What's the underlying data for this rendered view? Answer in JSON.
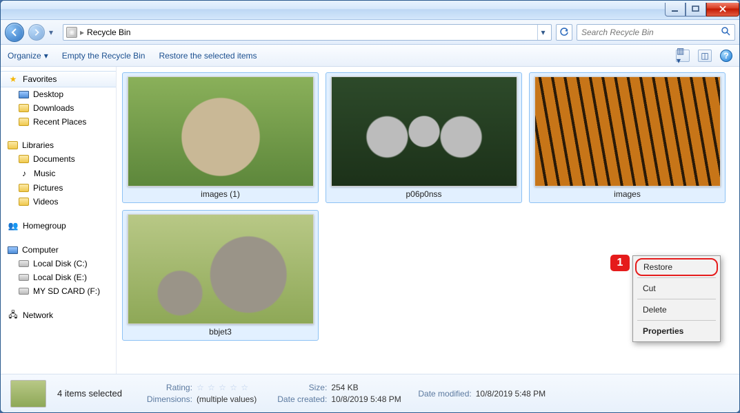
{
  "window": {
    "title": "Recycle Bin"
  },
  "nav": {
    "breadcrumb": "Recycle Bin",
    "search_placeholder": "Search Recycle Bin"
  },
  "toolbar": {
    "organize": "Organize",
    "empty": "Empty the Recycle Bin",
    "restore": "Restore the selected items"
  },
  "sidebar": {
    "favorites": {
      "label": "Favorites",
      "items": [
        "Desktop",
        "Downloads",
        "Recent Places"
      ]
    },
    "libraries": {
      "label": "Libraries",
      "items": [
        "Documents",
        "Music",
        "Pictures",
        "Videos"
      ]
    },
    "homegroup": {
      "label": "Homegroup"
    },
    "computer": {
      "label": "Computer",
      "items": [
        "Local Disk (C:)",
        "Local Disk (E:)",
        "MY SD CARD (F:)"
      ]
    },
    "network": {
      "label": "Network"
    }
  },
  "items": [
    {
      "name": "images (1)",
      "selected": true,
      "style": "raccoon"
    },
    {
      "name": "p06p0nss",
      "selected": true,
      "style": "lemurs"
    },
    {
      "name": "images",
      "selected": true,
      "style": "tiger"
    },
    {
      "name": "bbjet3",
      "selected": true,
      "style": "elephants"
    }
  ],
  "context_menu": {
    "restore": "Restore",
    "cut": "Cut",
    "delete": "Delete",
    "properties": "Properties"
  },
  "callout": "1",
  "details": {
    "title": "4 items selected",
    "rating_label": "Rating:",
    "dimensions_label": "Dimensions:",
    "dimensions_value": "(multiple values)",
    "size_label": "Size:",
    "size_value": "254 KB",
    "created_label": "Date created:",
    "created_value": "10/8/2019 5:48 PM",
    "modified_label": "Date modified:",
    "modified_value": "10/8/2019 5:48 PM"
  }
}
